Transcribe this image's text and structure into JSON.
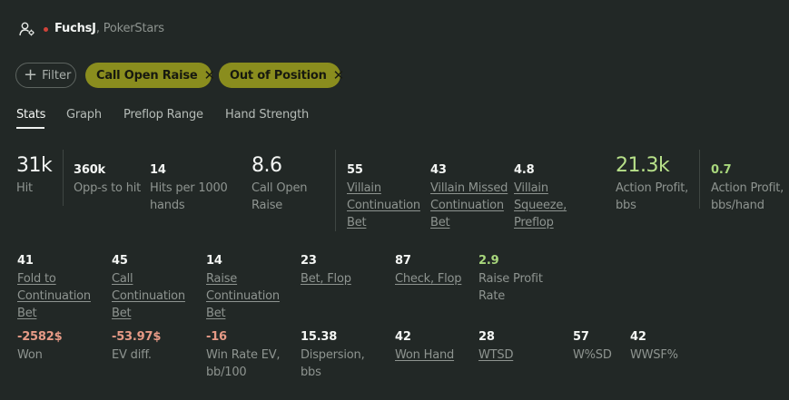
{
  "player": {
    "name": "FuchsJ",
    "site": ", PokerStars"
  },
  "filters": {
    "filter_label": "Filter",
    "chips": [
      {
        "label": "Call Open Raise"
      },
      {
        "label": "Out of Position"
      }
    ]
  },
  "tabs": [
    {
      "label": "Stats",
      "active": true
    },
    {
      "label": "Graph"
    },
    {
      "label": "Preflop Range"
    },
    {
      "label": "Hand Strength"
    }
  ],
  "stats_top": [
    {
      "value": "31k",
      "label": "Hit"
    },
    {
      "value": "360k",
      "label": "Opp-s to hit"
    },
    {
      "value": "14",
      "label": "Hits per 1000 hands"
    },
    {
      "value": "8.6",
      "label": "Call Open Raise"
    },
    {
      "value": "55",
      "label": "Villain Continuation Bet"
    },
    {
      "value": "43",
      "label": "Villain Missed Continuation Bet"
    },
    {
      "value": "4.8",
      "label": "Villain Squeeze, Preflop"
    },
    {
      "value": "21.3k",
      "label": "Action Profit, bbs"
    },
    {
      "value": "0.7",
      "label": "Action Profit, bbs/hand"
    }
  ],
  "stats_mid": [
    {
      "value": "41",
      "label": "Fold to Continuation Bet"
    },
    {
      "value": "45",
      "label": "Call Continuation Bet"
    },
    {
      "value": "14",
      "label": "Raise Continuation Bet"
    },
    {
      "value": "23",
      "label": "Bet, Flop"
    },
    {
      "value": "87",
      "label": "Check, Flop"
    },
    {
      "value": "2.9",
      "label": "Raise Profit Rate"
    }
  ],
  "stats_bottom": [
    {
      "value": "-2582$",
      "label": "Won"
    },
    {
      "value": "-53.97$",
      "label": "EV diff."
    },
    {
      "value": "-16",
      "label": "Win Rate EV, bb/100"
    },
    {
      "value": "15.38",
      "label": "Dispersion, bbs"
    },
    {
      "value": "42",
      "label": "Won Hand"
    },
    {
      "value": "28",
      "label": "WTSD"
    },
    {
      "value": "57",
      "label": "W%SD"
    },
    {
      "value": "42",
      "label": "WWSF%"
    }
  ],
  "colors": {
    "background": "#222826",
    "chip": "#8a8d1e",
    "positive": "#b7e089",
    "negative": "#e69a86",
    "status_dot": "#d0433a"
  },
  "icons": {
    "player": "user-gear-icon",
    "filter": "plus-icon",
    "chip_remove": "close-icon"
  }
}
